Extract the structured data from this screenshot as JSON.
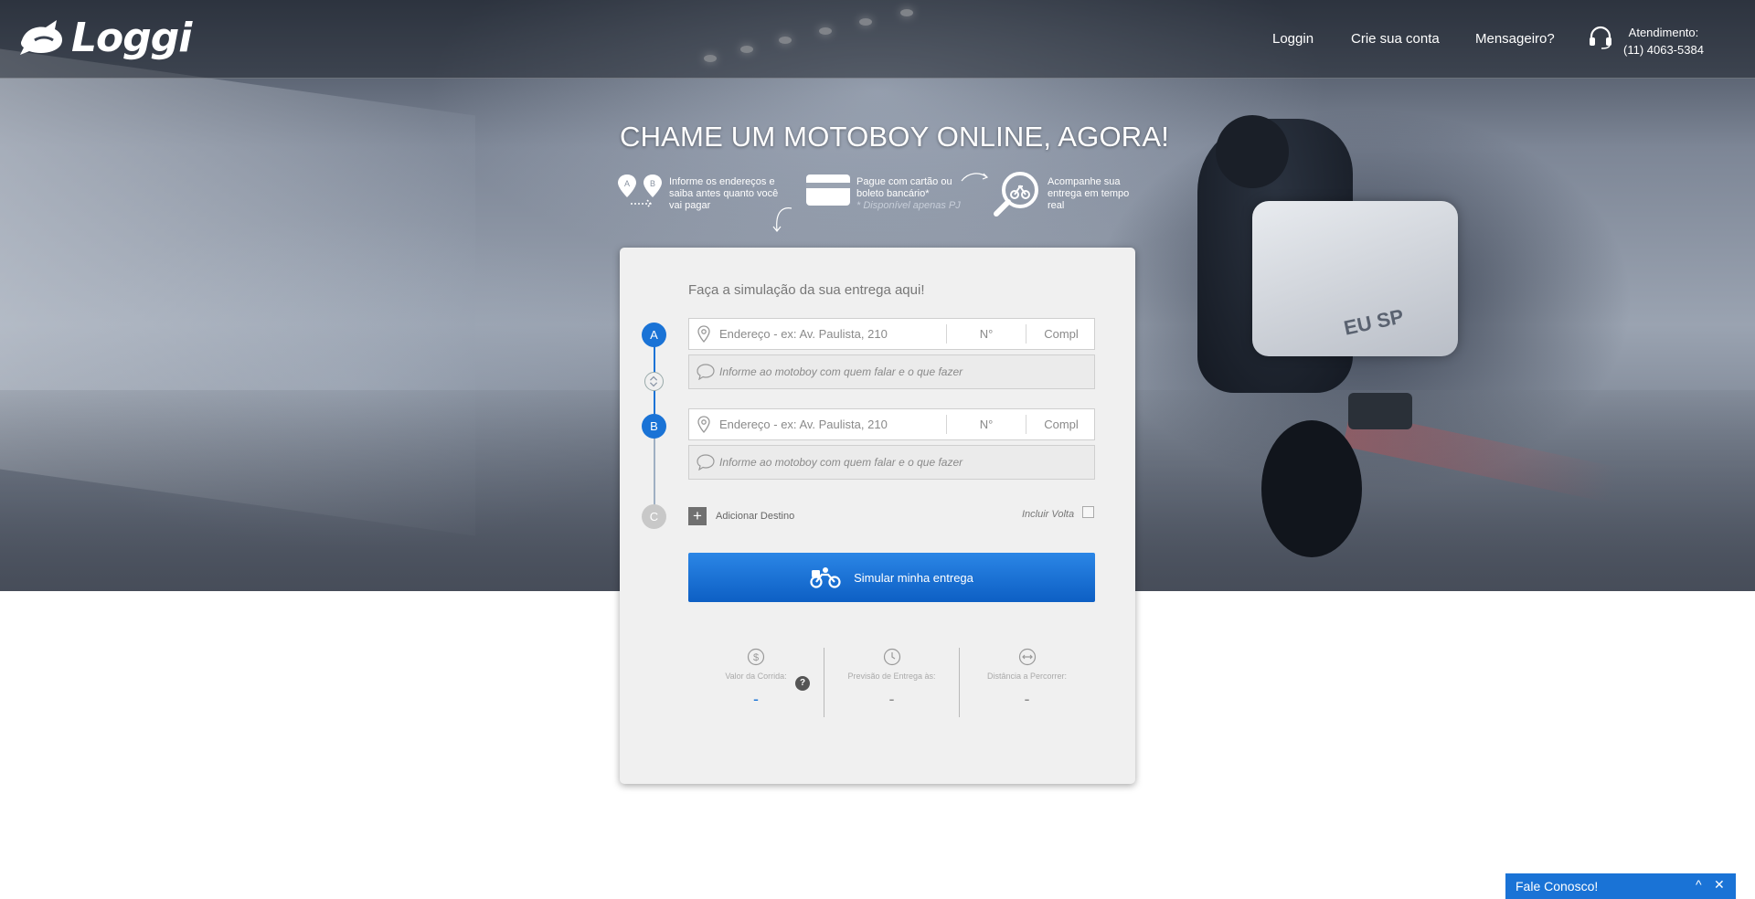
{
  "brand": {
    "name": "Loggi"
  },
  "nav": {
    "loggin": "Loggin",
    "crie_conta": "Crie sua conta",
    "mensageiro": "Mensageiro?",
    "atendimento_label": "Atendimento:",
    "atendimento_phone": "(11) 4063-5384"
  },
  "hero": {
    "headline": "CHAME UM MOTOBOY ONLINE, AGORA!",
    "features": [
      {
        "text": "Informe os endereços e saiba antes quanto você vai pagar",
        "icon": "map-pins-ab-icon"
      },
      {
        "text": "Pague com cartão ou boleto bancário*",
        "note": "* Disponível apenas PJ",
        "icon": "credit-card-icon"
      },
      {
        "text": "Acompanhe sua entrega em tempo real",
        "icon": "magnifier-moto-icon"
      }
    ],
    "bike_box_text": "EU SP"
  },
  "form": {
    "title": "Faça a simulação da sua entrega aqui!",
    "steps": [
      "A",
      "B",
      "C"
    ],
    "address_placeholder": "Endereço - ex: Av. Paulista, 210",
    "number_placeholder": "N°",
    "compl_placeholder": "Compl",
    "note_placeholder": "Informe ao motoboy com quem falar e o que fazer",
    "add_destination": "Adicionar Destino",
    "include_return": "Incluir Volta",
    "include_return_checked": false,
    "simulate_button": "Simular minha entrega"
  },
  "results": {
    "valor_label": "Valor da Corrida:",
    "valor_value": "-",
    "previsao_label": "Previsão de Entrega às:",
    "previsao_value": "-",
    "distancia_label": "Distância a Percorrer:",
    "distancia_value": "-",
    "help": "?"
  },
  "chat": {
    "label": "Fale Conosco!",
    "minimize": "^",
    "close": "✕"
  },
  "colors": {
    "primary": "#1a73d6",
    "card_bg": "#f0f0f0",
    "step_inactive": "#c8c8c8"
  }
}
